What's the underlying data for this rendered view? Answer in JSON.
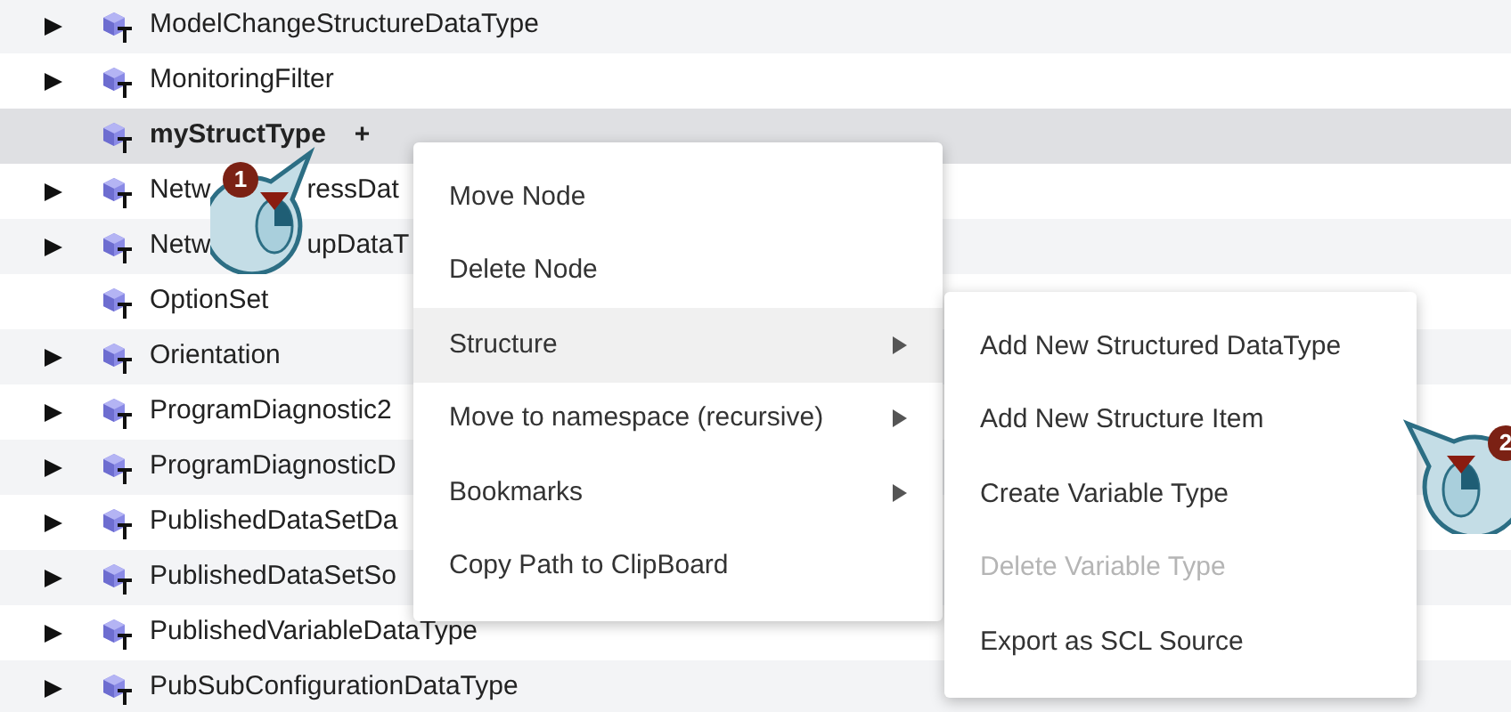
{
  "tree": {
    "rows": [
      {
        "label": "ModelChangeStructureDataType",
        "expandable": true,
        "selected": false
      },
      {
        "label": "MonitoringFilter",
        "expandable": true,
        "selected": false
      },
      {
        "label": "myStructType",
        "expandable": false,
        "selected": true,
        "action": "+"
      },
      {
        "label": "Netw",
        "label_continued": "ressDat",
        "expandable": true,
        "selected": false
      },
      {
        "label": "Netw",
        "label_continued": "upDataT",
        "expandable": true,
        "selected": false
      },
      {
        "label": "OptionSet",
        "expandable": false,
        "selected": false
      },
      {
        "label": "Orientation",
        "expandable": true,
        "selected": false
      },
      {
        "label": "ProgramDiagnostic2",
        "expandable": true,
        "selected": false
      },
      {
        "label": "ProgramDiagnosticD",
        "expandable": true,
        "selected": false
      },
      {
        "label": "PublishedDataSetDa",
        "expandable": true,
        "selected": false
      },
      {
        "label": "PublishedDataSetSo",
        "expandable": true,
        "selected": false
      },
      {
        "label": "PublishedVariableDataType",
        "expandable": true,
        "selected": false
      },
      {
        "label": "PubSubConfigurationDataType",
        "expandable": true,
        "selected": false
      }
    ]
  },
  "context_menu": {
    "items": [
      {
        "label": "Move Node",
        "submenu": false,
        "highlighted": false
      },
      {
        "label": "Delete Node",
        "submenu": false,
        "highlighted": false
      },
      {
        "label": "Structure",
        "submenu": true,
        "highlighted": true
      },
      {
        "label": "Move to namespace (recursive)",
        "submenu": true,
        "highlighted": false
      },
      {
        "label": "Bookmarks",
        "submenu": true,
        "highlighted": false
      },
      {
        "label": "Copy Path to ClipBoard",
        "submenu": false,
        "highlighted": false
      }
    ]
  },
  "submenu": {
    "items": [
      {
        "label": "Add New Structured DataType",
        "disabled": false
      },
      {
        "label": "Add New Structure Item",
        "disabled": false
      },
      {
        "label": "Create Variable Type",
        "disabled": false
      },
      {
        "label": "Delete Variable Type",
        "disabled": true
      },
      {
        "label": "Export as SCL Source",
        "disabled": false
      }
    ]
  },
  "callouts": [
    {
      "number": "1"
    },
    {
      "number": "2"
    }
  ]
}
